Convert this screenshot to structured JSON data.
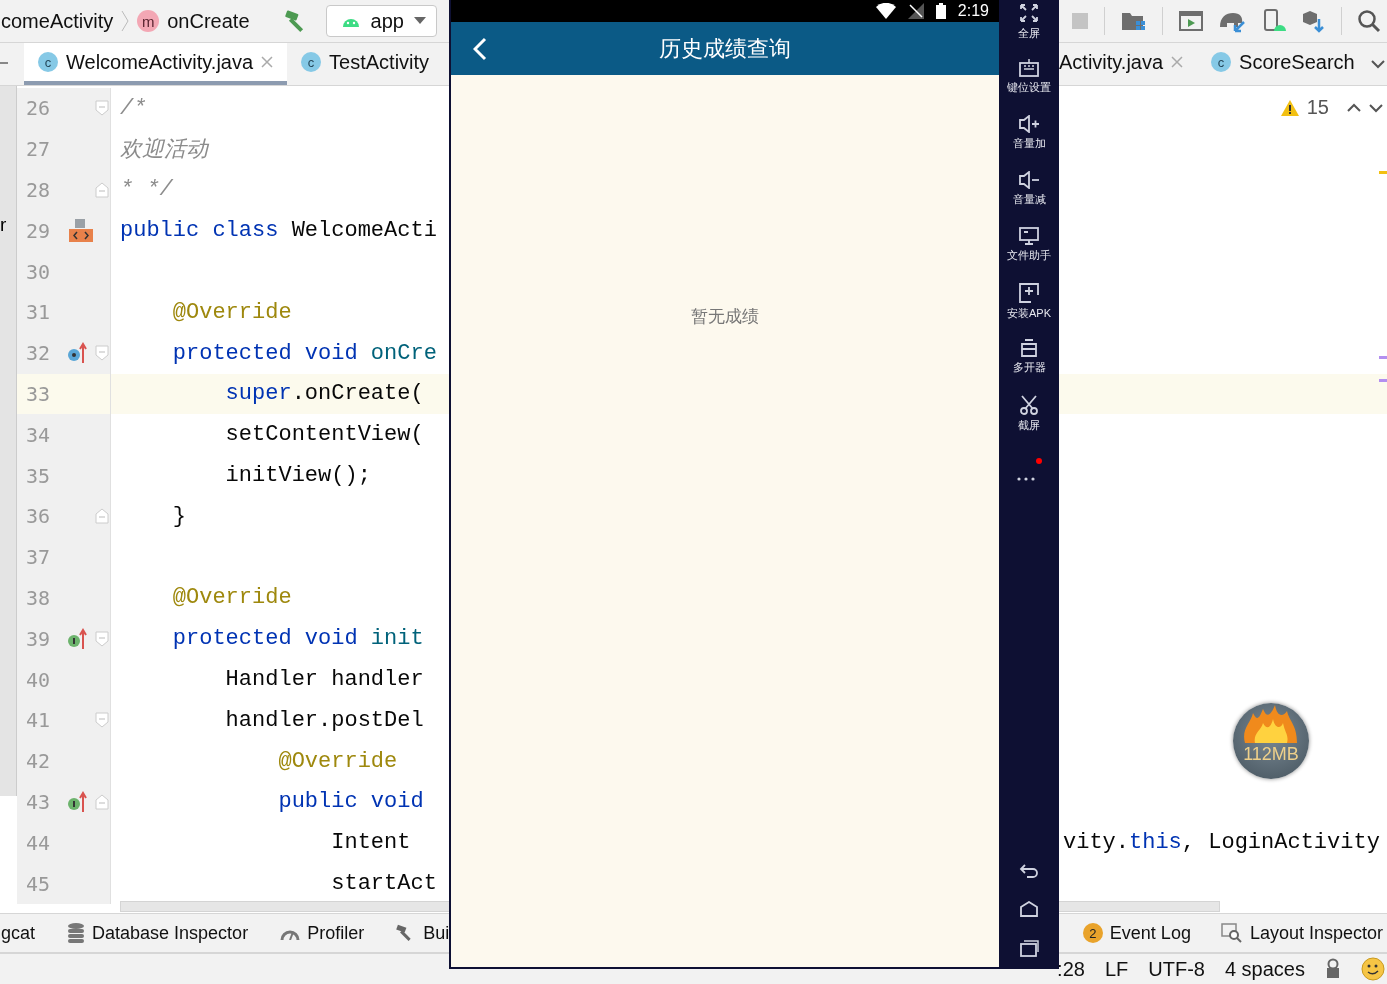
{
  "toolbar": {
    "breadcrumb_class": "comeActivity",
    "method_badge": "m",
    "breadcrumb_method": "onCreate",
    "run_config": "app"
  },
  "tabs_left": [
    {
      "label": "WelcomeActivity.java",
      "badge": "c",
      "selected": true,
      "closable": true
    },
    {
      "label": "TestActivity",
      "badge": "c",
      "selected": false,
      "closable": false
    }
  ],
  "tabs_right": [
    {
      "label": "Activity.java",
      "selected": false,
      "closable": true
    },
    {
      "label": "ScoreSearch",
      "badge": "c",
      "selected": false,
      "closable": false
    }
  ],
  "left_panel_fragment": "r",
  "editor": {
    "warning_count": "15",
    "lines": [
      {
        "number": "26",
        "current": false,
        "tokens": [
          {
            "kind": "comment",
            "text": "/*"
          }
        ]
      },
      {
        "number": "27",
        "current": false,
        "tokens": [
          {
            "kind": "comment",
            "text": "欢迎活动"
          }
        ]
      },
      {
        "number": "28",
        "current": false,
        "tokens": [
          {
            "kind": "comment",
            "text": "* */"
          }
        ]
      },
      {
        "number": "29",
        "current": false,
        "tokens": [
          {
            "kind": "keyword",
            "text": "public "
          },
          {
            "kind": "keyword",
            "text": "class "
          },
          {
            "kind": "plain",
            "text": "WelcomeActi"
          }
        ]
      },
      {
        "number": "30",
        "current": false
      },
      {
        "number": "31",
        "current": false,
        "tokens": [
          {
            "kind": "annotation",
            "text": "    @Override"
          }
        ]
      },
      {
        "number": "32",
        "current": false,
        "tokens": [
          {
            "kind": "keyword",
            "text": "    protected "
          },
          {
            "kind": "keyword",
            "text": "void "
          },
          {
            "kind": "method",
            "text": "onCre"
          }
        ]
      },
      {
        "number": "33",
        "current": true,
        "tokens": [
          {
            "kind": "keyword",
            "text": "        super"
          },
          {
            "kind": "plain",
            "text": ".onCreate("
          }
        ]
      },
      {
        "number": "34",
        "current": false,
        "tokens": [
          {
            "kind": "plain",
            "text": "        setContentView("
          }
        ]
      },
      {
        "number": "35",
        "current": false,
        "tokens": [
          {
            "kind": "plain",
            "text": "        initView();"
          }
        ]
      },
      {
        "number": "36",
        "current": false,
        "tokens": [
          {
            "kind": "plain",
            "text": "    }"
          }
        ]
      },
      {
        "number": "37",
        "current": false
      },
      {
        "number": "38",
        "current": false,
        "tokens": [
          {
            "kind": "annotation",
            "text": "    @Override"
          }
        ]
      },
      {
        "number": "39",
        "current": false,
        "tokens": [
          {
            "kind": "keyword",
            "text": "    protected "
          },
          {
            "kind": "keyword",
            "text": "void "
          },
          {
            "kind": "method",
            "text": "init"
          }
        ]
      },
      {
        "number": "40",
        "current": false,
        "tokens": [
          {
            "kind": "plain",
            "text": "        Handler handler"
          }
        ]
      },
      {
        "number": "41",
        "current": false,
        "tokens": [
          {
            "kind": "plain",
            "text": "        handler.postDel"
          }
        ]
      },
      {
        "number": "42",
        "current": false,
        "tokens": [
          {
            "kind": "annotation",
            "text": "            @Override"
          }
        ]
      },
      {
        "number": "43",
        "current": false,
        "tokens": [
          {
            "kind": "keyword",
            "text": "            public "
          },
          {
            "kind": "keyword",
            "text": "void"
          }
        ]
      },
      {
        "number": "44",
        "current": false,
        "tokens": [
          {
            "kind": "plain",
            "text": "                Intent"
          }
        ],
        "right_tokens": [
          {
            "kind": "plain",
            "text": "vity."
          },
          {
            "kind": "keyword",
            "text": "this"
          },
          {
            "kind": "plain",
            "text": ", LoginActivity"
          }
        ]
      },
      {
        "number": "45",
        "current": false,
        "tokens": [
          {
            "kind": "plain",
            "text": "                startAct"
          }
        ]
      }
    ]
  },
  "memory_indicator": "112MB",
  "tool_windows_left": [
    {
      "label": "gcat"
    },
    {
      "label": "Database Inspector"
    },
    {
      "label": "Profiler"
    },
    {
      "label": "Bui"
    }
  ],
  "tool_windows_right": [
    {
      "label": "Event Log",
      "badge": "2"
    },
    {
      "label": "Layout Inspector"
    }
  ],
  "status_bar": [
    ":28",
    "LF",
    "UTF-8",
    "4 spaces"
  ],
  "emulator": {
    "time": "2:19",
    "title": "历史成绩查询",
    "empty_message": "暂无成绩",
    "tools": [
      {
        "label": "全屏"
      },
      {
        "label": "键位设置"
      },
      {
        "label": "音量加"
      },
      {
        "label": "音量减"
      },
      {
        "label": "文件助手"
      },
      {
        "label": "安装APK"
      },
      {
        "label": "多开器"
      },
      {
        "label": "截屏"
      }
    ],
    "more_notification": true
  }
}
